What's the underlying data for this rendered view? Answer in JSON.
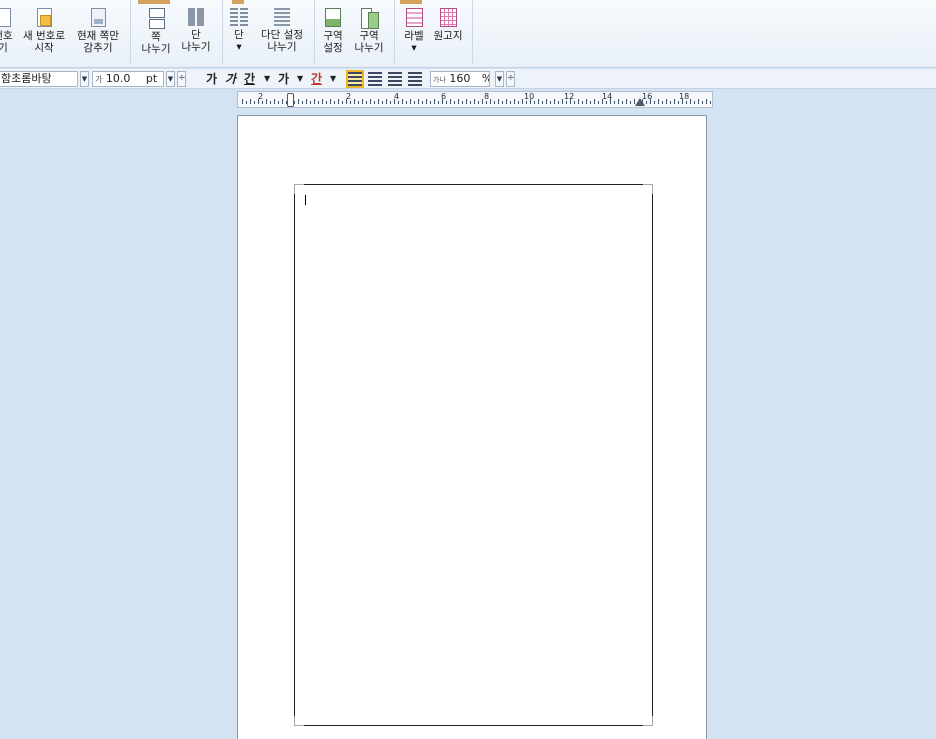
{
  "ribbon": {
    "buttons": [
      {
        "icon": "page-number-icon",
        "line1": "번호",
        "line2": "기"
      },
      {
        "icon": "new-number-start-icon",
        "line1": "새 번호로",
        "line2": "시작"
      },
      {
        "icon": "hide-current-page-icon",
        "line1": "현재 쪽만",
        "line2": "감추기"
      },
      {
        "icon": "page-break-icon",
        "line1": "쪽",
        "line2": "나누기"
      },
      {
        "icon": "column-break-icon",
        "line1": "단",
        "line2": "나누기"
      },
      {
        "icon": "columns-icon",
        "line1": "단",
        "line2": "▾"
      },
      {
        "icon": "multi-column-settings-icon",
        "line1": "다단 설정",
        "line2": "나누기"
      },
      {
        "icon": "section-settings-icon",
        "line1": "구역",
        "line2": "설정"
      },
      {
        "icon": "section-break-icon",
        "line1": "구역",
        "line2": "나누기"
      },
      {
        "icon": "label-icon",
        "line1": "라벨",
        "line2": "▾"
      },
      {
        "icon": "manuscript-paper-icon",
        "line1": "원고지",
        "line2": ""
      }
    ]
  },
  "format_bar": {
    "font_name": "함초롬바탕",
    "font_size": "10.0",
    "font_size_prefix": "가",
    "size_unit": "pt",
    "bold_label": "가",
    "italic_label": "가",
    "underline_label": "간",
    "char_color_label": "가",
    "highlight_label": "간",
    "line_spacing_icon": "가나",
    "line_spacing": "160",
    "line_spacing_unit": "%"
  },
  "ruler": {
    "labels": [
      "2",
      "2",
      "4",
      "6",
      "8",
      "10",
      "12",
      "14",
      "16",
      "18"
    ]
  },
  "colors": {
    "workspace": "#d3e3f1",
    "ribbon": "#eef3f9",
    "page": "#ffffff"
  }
}
